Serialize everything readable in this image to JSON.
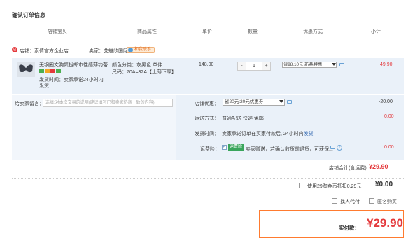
{
  "page": {
    "title": "确认订单信息"
  },
  "header": {
    "columns": [
      "店铺宝贝",
      "商品属性",
      "单价",
      "数量",
      "优惠方式",
      "小计"
    ]
  },
  "shop": {
    "label": "店铺：",
    "name": "索倩官方企业店",
    "seller_label": "卖家：",
    "seller": "艾魅欣国际",
    "contact_label": "和我联系"
  },
  "item": {
    "title": "无钢圈文胸聚拢邮市性感薄钓蕾...",
    "ship_time": "发货时间：卖家承诺24小时内发货",
    "color": "颜色分类：灰黑色 单件",
    "size": "尺码：70A=32A【上薄下厚】",
    "price": "148.00",
    "qty": "1",
    "minus": "-",
    "plus": "+",
    "promo": "省98.10元:新品特惠",
    "subtotal": "49.90"
  },
  "message": {
    "label": "给卖家留言：",
    "placeholder": "选填:对本次交易的说明(建议填写已和卖家协商一致的内容)"
  },
  "coupon": {
    "label": "店铺优惠：",
    "value": "省20元:20元优惠券",
    "amount": "-20.00"
  },
  "shipping": {
    "label": "运送方式：",
    "value": "普通配送 快递 免邮",
    "amount": "0.00"
  },
  "delivery": {
    "label": "发货时间：",
    "value": "卖家承诺订单在买家付款后, 24小时内",
    "link": "发货"
  },
  "insurance": {
    "label": "运费险：",
    "badge": "运费险",
    "value": "卖家赠送，若确认收货前退货，可获保...",
    "amount": "0.00"
  },
  "shop_total": {
    "label": "店铺合计(含运费)",
    "value": "¥29.90"
  },
  "jifen": {
    "label": "使用29淘金币抵扣0.29元",
    "value": "¥0.00"
  },
  "options": {
    "proxy": "找人代付",
    "anonymous": "匿名购买"
  },
  "payment": {
    "label": "实付款：",
    "value": "¥29.90"
  }
}
